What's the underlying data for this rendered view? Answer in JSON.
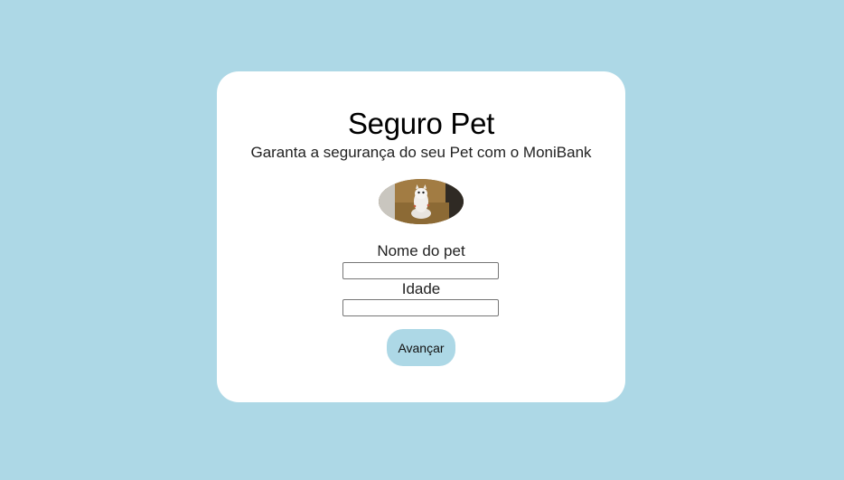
{
  "page": {
    "background_color": "#add8e6"
  },
  "card": {
    "title": "Seguro Pet",
    "subtitle": "Garanta a segurança do seu Pet com o MoniBank",
    "image_icon": "pet-photo"
  },
  "form": {
    "name_label": "Nome do pet",
    "name_value": "",
    "age_label": "Idade",
    "age_value": "",
    "submit_label": "Avançar",
    "submit_color": "#add8e6"
  }
}
